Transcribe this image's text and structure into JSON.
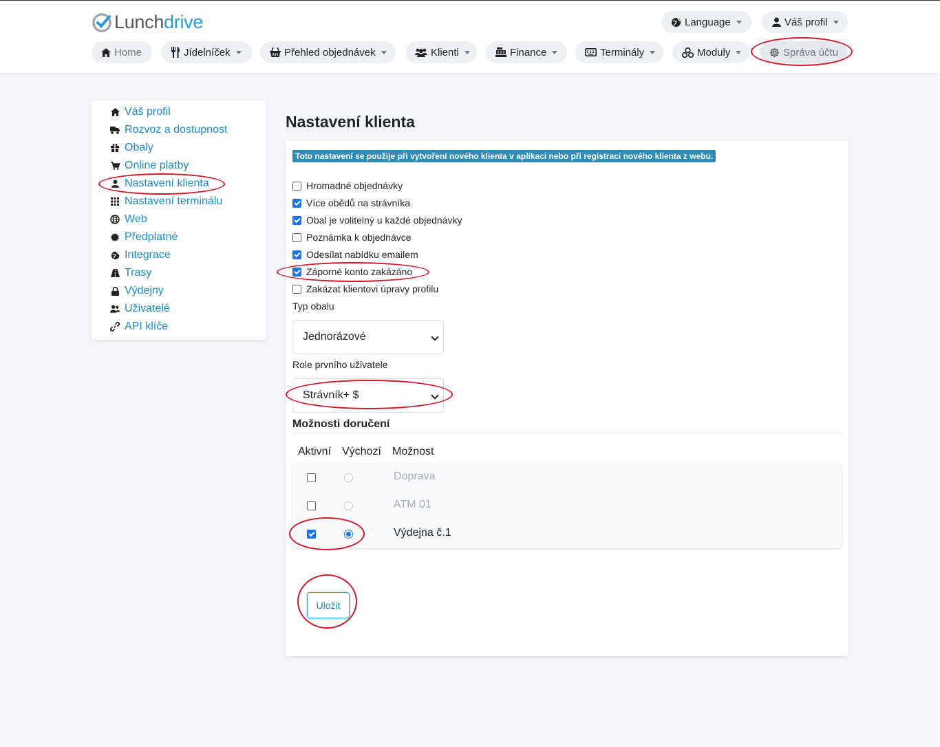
{
  "brand": {
    "part1": "Lunch",
    "part2": "drive"
  },
  "top_nav": {
    "language": "Language",
    "profile": "Váš profil",
    "items": [
      {
        "label": "Home"
      },
      {
        "label": "Jídelníček"
      },
      {
        "label": "Přehled objednávek"
      },
      {
        "label": "Klienti"
      },
      {
        "label": "Finance"
      },
      {
        "label": "Terminály"
      },
      {
        "label": "Moduly"
      },
      {
        "label": "Správa účtu"
      }
    ]
  },
  "sidebar": {
    "items": [
      {
        "label": "Váš profil",
        "icon": "home-icon"
      },
      {
        "label": "Rozvoz a dostupnost",
        "icon": "truck-icon"
      },
      {
        "label": "Obaly",
        "icon": "gift-icon"
      },
      {
        "label": "Online platby",
        "icon": "cart-icon"
      },
      {
        "label": "Nastavení klienta",
        "icon": "user-icon"
      },
      {
        "label": "Nastavení terminálu",
        "icon": "grid-icon"
      },
      {
        "label": "Web",
        "icon": "globe-icon"
      },
      {
        "label": "Předplatné",
        "icon": "certificate-icon"
      },
      {
        "label": "Integrace",
        "icon": "globe-americas-icon"
      },
      {
        "label": "Trasy",
        "icon": "road-icon"
      },
      {
        "label": "Výdejny",
        "icon": "lock-icon"
      },
      {
        "label": "Uživatelé",
        "icon": "users-icon"
      },
      {
        "label": "API klíče",
        "icon": "link-icon"
      }
    ]
  },
  "main": {
    "title": "Nastavení klienta",
    "info": "Toto nastavení se použije při vytvoření nového klienta v aplikaci nebo při registraci nového klienta z webu.",
    "checkboxes": [
      {
        "label": "Hromadné objednávky",
        "checked": false
      },
      {
        "label": "Více obědů na strávníka",
        "checked": true
      },
      {
        "label": "Obal je volitelný u každé objednávky",
        "checked": true
      },
      {
        "label": "Poznámka k objednávce",
        "checked": false
      },
      {
        "label": "Odesílat nabídku emailem",
        "checked": true
      },
      {
        "label": "Záporné konto zakázáno",
        "checked": true
      },
      {
        "label": "Zakázat klientovi úpravy profilu",
        "checked": false
      }
    ],
    "package_type": {
      "label": "Typ obalu",
      "value": "Jednorázové"
    },
    "first_user_role": {
      "label": "Role prvního uživatele",
      "value": "Strávník+ $"
    },
    "delivery": {
      "title": "Možnosti doručení",
      "headers": {
        "active": "Aktivní",
        "default": "Výchozí",
        "option": "Možnost"
      },
      "rows": [
        {
          "name": "Doprava",
          "active": false,
          "default": false,
          "disabled": true
        },
        {
          "name": "ATM 01",
          "active": false,
          "default": false,
          "disabled": true
        },
        {
          "name": "Výdejna č.1",
          "active": true,
          "default": true,
          "disabled": false
        }
      ]
    },
    "save_label": "Uložit"
  },
  "colors": {
    "link": "#1a8bc7",
    "badge": "#2d8cb8",
    "annotation": "#d01a2b",
    "check": "#1a73e8"
  }
}
